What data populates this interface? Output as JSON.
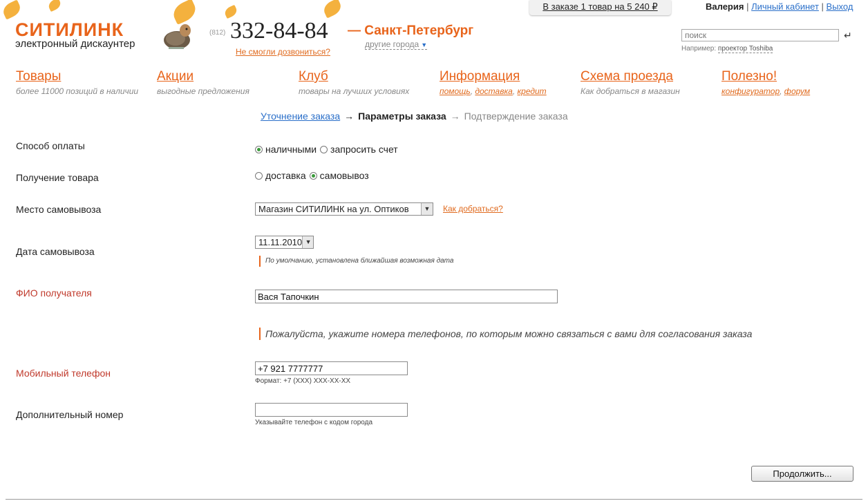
{
  "header": {
    "logo": "СИТИЛИНК",
    "logo_sub": "электронный дискаунтер",
    "phone_code": "(812)",
    "phone": "332-84-84",
    "callback_link": "Не смогли дозвониться?",
    "city": "— Санкт-Петербург",
    "other_cities": "другие города",
    "cart": "В заказе 1 товар на 5 240 ₽",
    "user_name": "Валерия",
    "cabinet_link": "Личный кабинет",
    "logout_link": "Выход",
    "separator": "|",
    "search_placeholder": "поиск",
    "search_hint_prefix": "Например:",
    "search_hint_example": "проектор Toshiba",
    "enter_icon": "↵"
  },
  "nav": [
    {
      "title": "Товары",
      "sub": "более 11000 позиций в наличии"
    },
    {
      "title": "Акции",
      "sub": "выгодные предложения"
    },
    {
      "title": "Клуб",
      "sub": "товары на лучших условиях"
    },
    {
      "title": "Информация",
      "links": [
        "помощь",
        "доставка",
        "кредит"
      ]
    },
    {
      "title": "Схема проезда",
      "sub": "Как добраться в магазин"
    },
    {
      "title": "Полезно!",
      "links": [
        "конфигуратор",
        "форум"
      ]
    }
  ],
  "steps": {
    "step1": "Уточнение заказа",
    "step2": "Параметры заказа",
    "step3": "Подтверждение заказа",
    "arrow": "→"
  },
  "form": {
    "payment_label": "Способ оплаты",
    "payment_opt1": "наличными",
    "payment_opt2": "запросить счет",
    "receive_label": "Получение товара",
    "receive_opt1": "доставка",
    "receive_opt2": "самовывоз",
    "pickup_place_label": "Место самовывоза",
    "pickup_place_value": "Магазин СИТИЛИНК на ул. Оптиков",
    "how_to_get_link": "Как добраться?",
    "pickup_date_label": "Дата самовывоза",
    "pickup_date_value": "11.11.2010",
    "pickup_date_note": "По умолчанию, установлена ближайшая возможная дата",
    "fio_label": "ФИО получателя",
    "fio_value": "Вася Тапочкин",
    "phones_note": "Пожалуйста, укажите номера телефонов, по которым можно связаться с вами для согласования заказа",
    "mobile_label": "Мобильный телефон",
    "mobile_value": "+7 921 7777777",
    "mobile_hint": "Формат: +7 (XXX) XXX-XX-XX",
    "extra_label": "Дополнительный номер",
    "extra_value": "",
    "extra_hint": "Указывайте телефон с кодом города",
    "continue_button": "Продолжить..."
  },
  "colors": {
    "accent": "#e8641b",
    "link_blue": "#2a6fc9",
    "required_red": "#c0392b"
  }
}
